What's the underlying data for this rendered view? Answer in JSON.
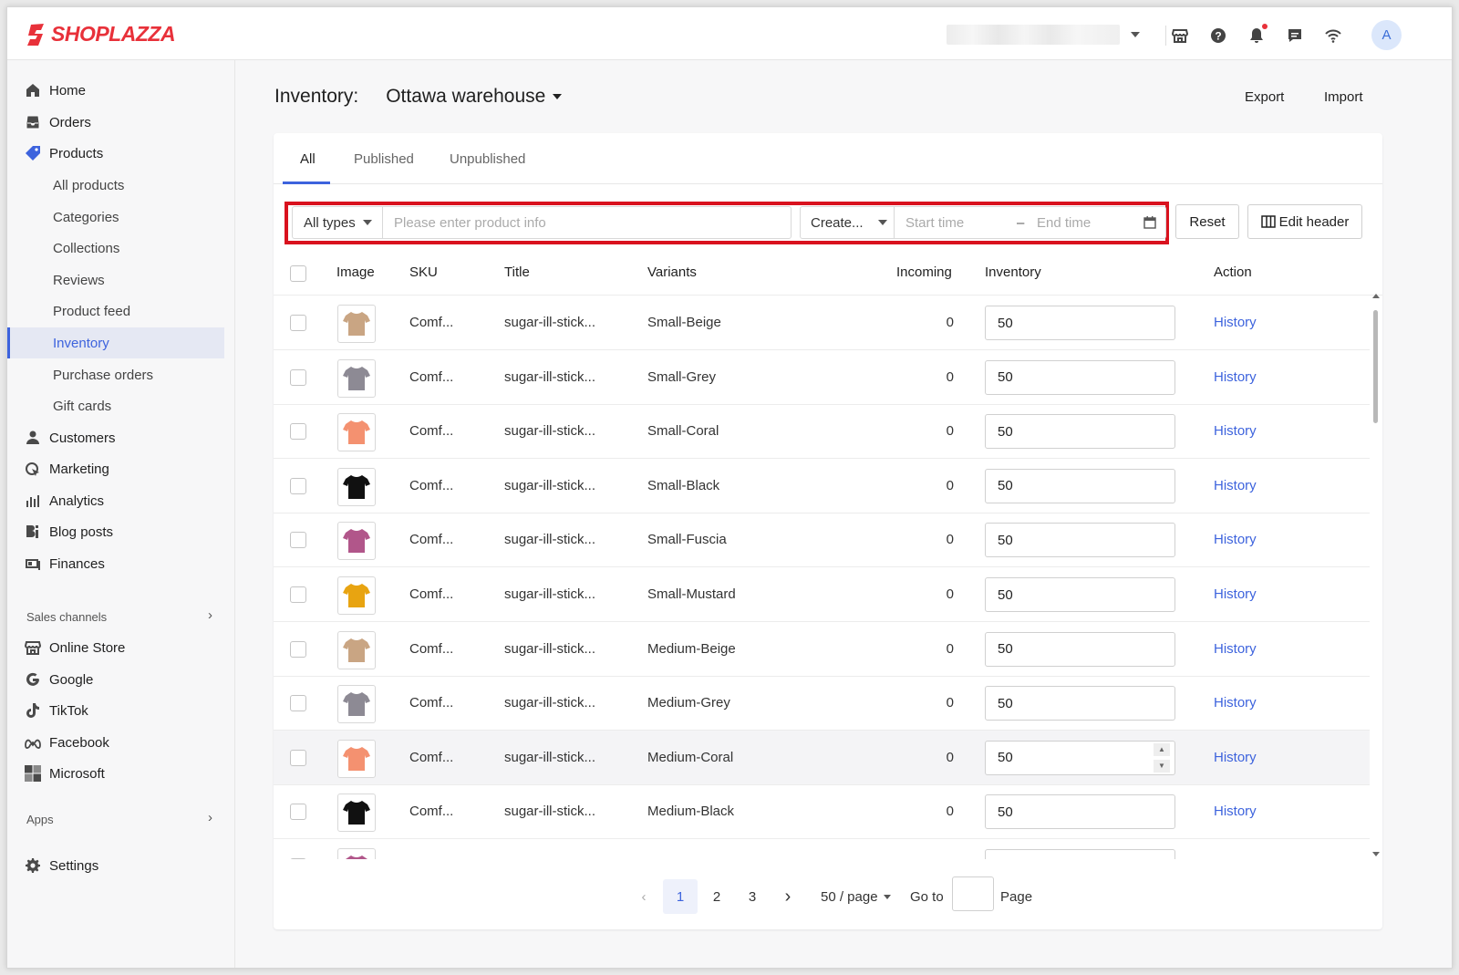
{
  "brand": {
    "name": "SHOPLAZZA",
    "color": "#e8313a"
  },
  "topbar": {
    "icons": [
      "store-icon",
      "help-icon",
      "bell-icon",
      "chat-icon",
      "wifi-icon"
    ],
    "avatar_letter": "A"
  },
  "sidebar": {
    "items": [
      {
        "label": "Home",
        "icon": "home-icon"
      },
      {
        "label": "Orders",
        "icon": "orders-icon"
      },
      {
        "label": "Products",
        "icon": "tag-icon"
      },
      {
        "label": "All products"
      },
      {
        "label": "Categories"
      },
      {
        "label": "Collections"
      },
      {
        "label": "Reviews"
      },
      {
        "label": "Product feed"
      },
      {
        "label": "Inventory",
        "active": true
      },
      {
        "label": "Purchase orders"
      },
      {
        "label": "Gift cards"
      },
      {
        "label": "Customers",
        "icon": "person-icon"
      },
      {
        "label": "Marketing",
        "icon": "marketing-icon"
      },
      {
        "label": "Analytics",
        "icon": "analytics-icon"
      },
      {
        "label": "Blog posts",
        "icon": "blog-icon"
      },
      {
        "label": "Finances",
        "icon": "finances-icon"
      }
    ],
    "sales_channels_label": "Sales channels",
    "channels": [
      {
        "label": "Online Store",
        "icon": "store-icon"
      },
      {
        "label": "Google",
        "icon": "google-icon"
      },
      {
        "label": "TikTok",
        "icon": "tiktok-icon"
      },
      {
        "label": "Facebook",
        "icon": "facebook-icon"
      },
      {
        "label": "Microsoft",
        "icon": "microsoft-icon"
      }
    ],
    "apps_label": "Apps",
    "settings_label": "Settings"
  },
  "page": {
    "title": "Inventory:",
    "warehouse": "Ottawa warehouse",
    "export_label": "Export",
    "import_label": "Import"
  },
  "tabs": [
    "All",
    "Published",
    "Unpublished"
  ],
  "filters": {
    "type": "All types",
    "search_placeholder": "Please enter product info",
    "sort": "Create...",
    "start_placeholder": "Start time",
    "range_separator": "–",
    "end_placeholder": "End time",
    "reset_label": "Reset",
    "edit_header_label": "Edit header"
  },
  "table": {
    "headers": {
      "image": "Image",
      "sku": "SKU",
      "title": "Title",
      "variants": "Variants",
      "incoming": "Incoming",
      "inventory": "Inventory",
      "action": "Action"
    },
    "rows": [
      {
        "sku": "Comf...",
        "title": "sugar-ill-stick...",
        "variant": "Small-Beige",
        "incoming": "0",
        "inventory": "50",
        "action": "History",
        "color": "#c9a583"
      },
      {
        "sku": "Comf...",
        "title": "sugar-ill-stick...",
        "variant": "Small-Grey",
        "incoming": "0",
        "inventory": "50",
        "action": "History",
        "color": "#8d8a94"
      },
      {
        "sku": "Comf...",
        "title": "sugar-ill-stick...",
        "variant": "Small-Coral",
        "incoming": "0",
        "inventory": "50",
        "action": "History",
        "color": "#f49170"
      },
      {
        "sku": "Comf...",
        "title": "sugar-ill-stick...",
        "variant": "Small-Black",
        "incoming": "0",
        "inventory": "50",
        "action": "History",
        "color": "#111111"
      },
      {
        "sku": "Comf...",
        "title": "sugar-ill-stick...",
        "variant": "Small-Fuscia",
        "incoming": "0",
        "inventory": "50",
        "action": "History",
        "color": "#b1568a"
      },
      {
        "sku": "Comf...",
        "title": "sugar-ill-stick...",
        "variant": "Small-Mustard",
        "incoming": "0",
        "inventory": "50",
        "action": "History",
        "color": "#e8a411"
      },
      {
        "sku": "Comf...",
        "title": "sugar-ill-stick...",
        "variant": "Medium-Beige",
        "incoming": "0",
        "inventory": "50",
        "action": "History",
        "color": "#c9a583"
      },
      {
        "sku": "Comf...",
        "title": "sugar-ill-stick...",
        "variant": "Medium-Grey",
        "incoming": "0",
        "inventory": "50",
        "action": "History",
        "color": "#8d8a94"
      },
      {
        "sku": "Comf...",
        "title": "sugar-ill-stick...",
        "variant": "Medium-Coral",
        "incoming": "0",
        "inventory": "50",
        "action": "History",
        "color": "#f49170"
      },
      {
        "sku": "Comf...",
        "title": "sugar-ill-stick...",
        "variant": "Medium-Black",
        "incoming": "0",
        "inventory": "50",
        "action": "History",
        "color": "#111111"
      },
      {
        "sku": "",
        "title": "",
        "variant": "",
        "incoming": "",
        "inventory": "",
        "action": "",
        "color": "#b1568a"
      }
    ]
  },
  "pagination": {
    "pages": [
      "1",
      "2",
      "3"
    ],
    "current": "1",
    "per_page": "50 / page",
    "goto_label": "Go to",
    "page_label": "Page"
  },
  "colors": {
    "accent": "#3d63dd",
    "highlight": "#d9121e"
  }
}
